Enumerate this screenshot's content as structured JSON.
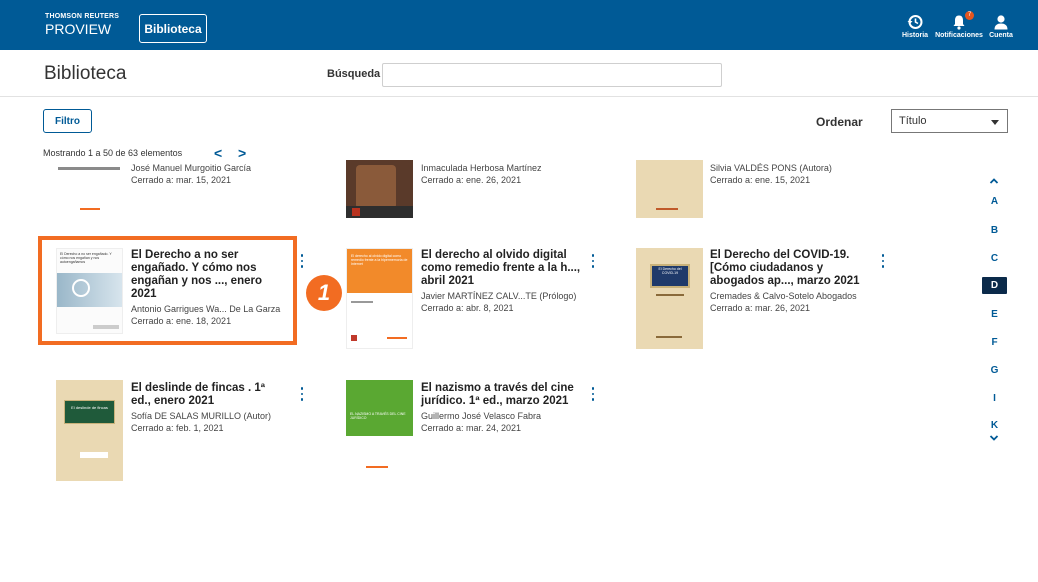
{
  "header": {
    "logo_line1": "THOMSON REUTERS",
    "logo_line2": "PROVIEW",
    "library_button": "Biblioteca",
    "history_label": "Historia",
    "notifications_label": "Notificaciones",
    "notifications_count": "7",
    "account_label": "Cuenta"
  },
  "page": {
    "title": "Biblioteca",
    "search_label": "Búsqueda",
    "search_value": "",
    "filter_button": "Filtro",
    "sort_label": "Ordenar",
    "sort_value": "Título",
    "count_text": "Mostrando 1 a 50 de 63 elementos",
    "prev": "<",
    "next": ">"
  },
  "cards": [
    {
      "title": "",
      "author": "José Manuel Murgoitio García",
      "closed": "Cerrado a: mar. 15, 2021"
    },
    {
      "title": "",
      "author": "Inmaculada Herbosa Martínez",
      "closed": "Cerrado a: ene. 26, 2021"
    },
    {
      "title": "",
      "author": "Silvia VALDÉS PONS (Autora)",
      "closed": "Cerrado a: ene. 15, 2021"
    },
    {
      "title": "El Derecho a no ser engañado. Y cómo nos engañan y nos ..., enero 2021",
      "author": "Antonio Garrigues Wa... De La Garza",
      "closed": "Cerrado a: ene. 18, 2021"
    },
    {
      "title": "El derecho al olvido digital como remedio frente a la h..., abril 2021",
      "author": "Javier MARTÍNEZ CALV...TE (Prólogo)",
      "closed": "Cerrado a: abr. 8, 2021"
    },
    {
      "title": "El Derecho del COVID-19. [Cómo ciudadanos y abogados ap..., marzo 2021",
      "author": "Cremades & Calvo-Sotelo Abogados",
      "closed": "Cerrado a: mar. 26, 2021"
    },
    {
      "title": "El deslinde de fincas . 1ª ed., enero 2021",
      "author": "Sofía DE SALAS MURILLO (Autor)",
      "closed": "Cerrado a: feb. 1, 2021"
    },
    {
      "title": "El nazismo a través del cine jurídico. 1ª ed., marzo 2021",
      "author": "Guillermo José Velasco Fabra",
      "closed": "Cerrado a: mar. 24, 2021"
    }
  ],
  "covers": {
    "c3_title": "El Derecho a no ser engañado. Y cómo nos engañan y nos autoengañamos",
    "c4_title": "El derecho al olvido digital como remedio frente a la hipermemoria de Internet",
    "c5_title": "El Derecho del COVID-19",
    "c6_title": "El deslinde de fincas",
    "c7_title": "EL NAZISMO A TRAVÉS DEL CINE JURÍDICO",
    "publisher": "ARANZADI"
  },
  "alpha_index": [
    "A",
    "B",
    "C",
    "D",
    "E",
    "F",
    "G",
    "I",
    "K"
  ],
  "alpha_active": "D",
  "step_number": "1",
  "colors": {
    "brand": "#005a96",
    "highlight": "#f26c22",
    "active_letter": "#0b2a4a"
  }
}
